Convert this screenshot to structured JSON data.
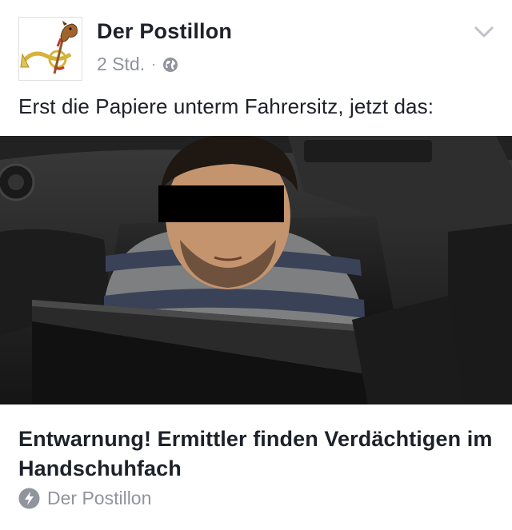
{
  "post": {
    "page_name": "Der Postillon",
    "timestamp": "2 Std.",
    "separator": "·",
    "audience_icon": "globe-icon",
    "menu_icon": "chevron-down-icon",
    "text": "Erst die Papiere unterm Fahrersitz, jetzt das:"
  },
  "link_preview": {
    "title": "Entwarnung! Ermittler finden Verdächtigen im Handschuhfach",
    "source": "Der Postillon",
    "source_icon": "instant-article-bolt-icon"
  },
  "colors": {
    "text_primary": "#1d2129",
    "text_secondary": "#90949c",
    "border": "#dddfe2"
  }
}
